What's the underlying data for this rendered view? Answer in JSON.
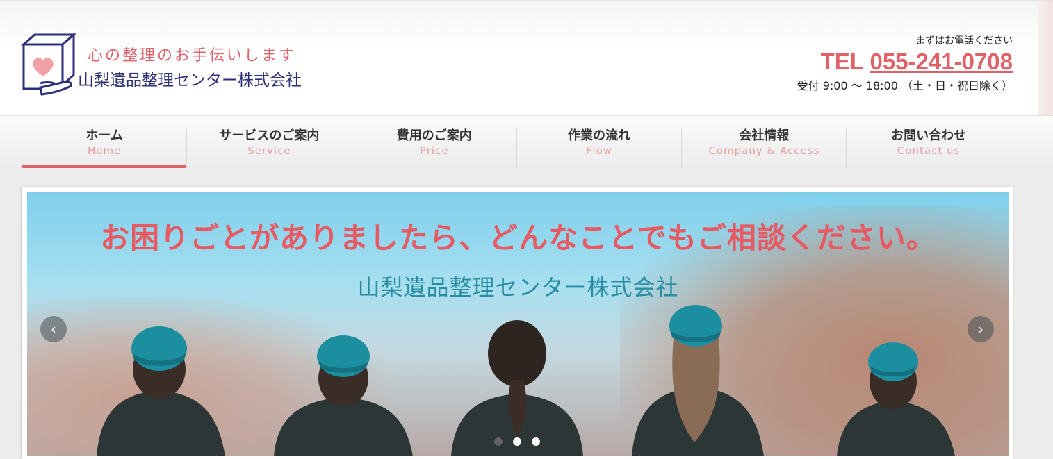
{
  "header": {
    "tagline": "心の整理のお手伝いします",
    "company": "山梨遺品整理センター株式会社",
    "contact_pre": "まずはお電話ください",
    "tel_label": "TEL",
    "tel_number": "055-241-0708",
    "hours": "受付 9:00 ～ 18:00 （土・日・祝日除く）"
  },
  "nav": {
    "items": [
      {
        "jp": "ホーム",
        "en": "Home"
      },
      {
        "jp": "サービスのご案内",
        "en": "Service"
      },
      {
        "jp": "費用のご案内",
        "en": "Price"
      },
      {
        "jp": "作業の流れ",
        "en": "Flow"
      },
      {
        "jp": "会社情報",
        "en": "Company & Access"
      },
      {
        "jp": "お問い合わせ",
        "en": "Contact us"
      }
    ],
    "active_index": 0
  },
  "slider": {
    "title": "お困りごとがありましたら、どんなことでもご相談ください。",
    "subtitle": "山梨遺品整理センター株式会社",
    "prev_glyph": "‹",
    "next_glyph": "›",
    "slide_count": 3,
    "current_slide": 1
  },
  "colors": {
    "accent": "#e06268",
    "brand_navy": "#2b2f7a",
    "cap_teal": "#1f8fa3"
  }
}
